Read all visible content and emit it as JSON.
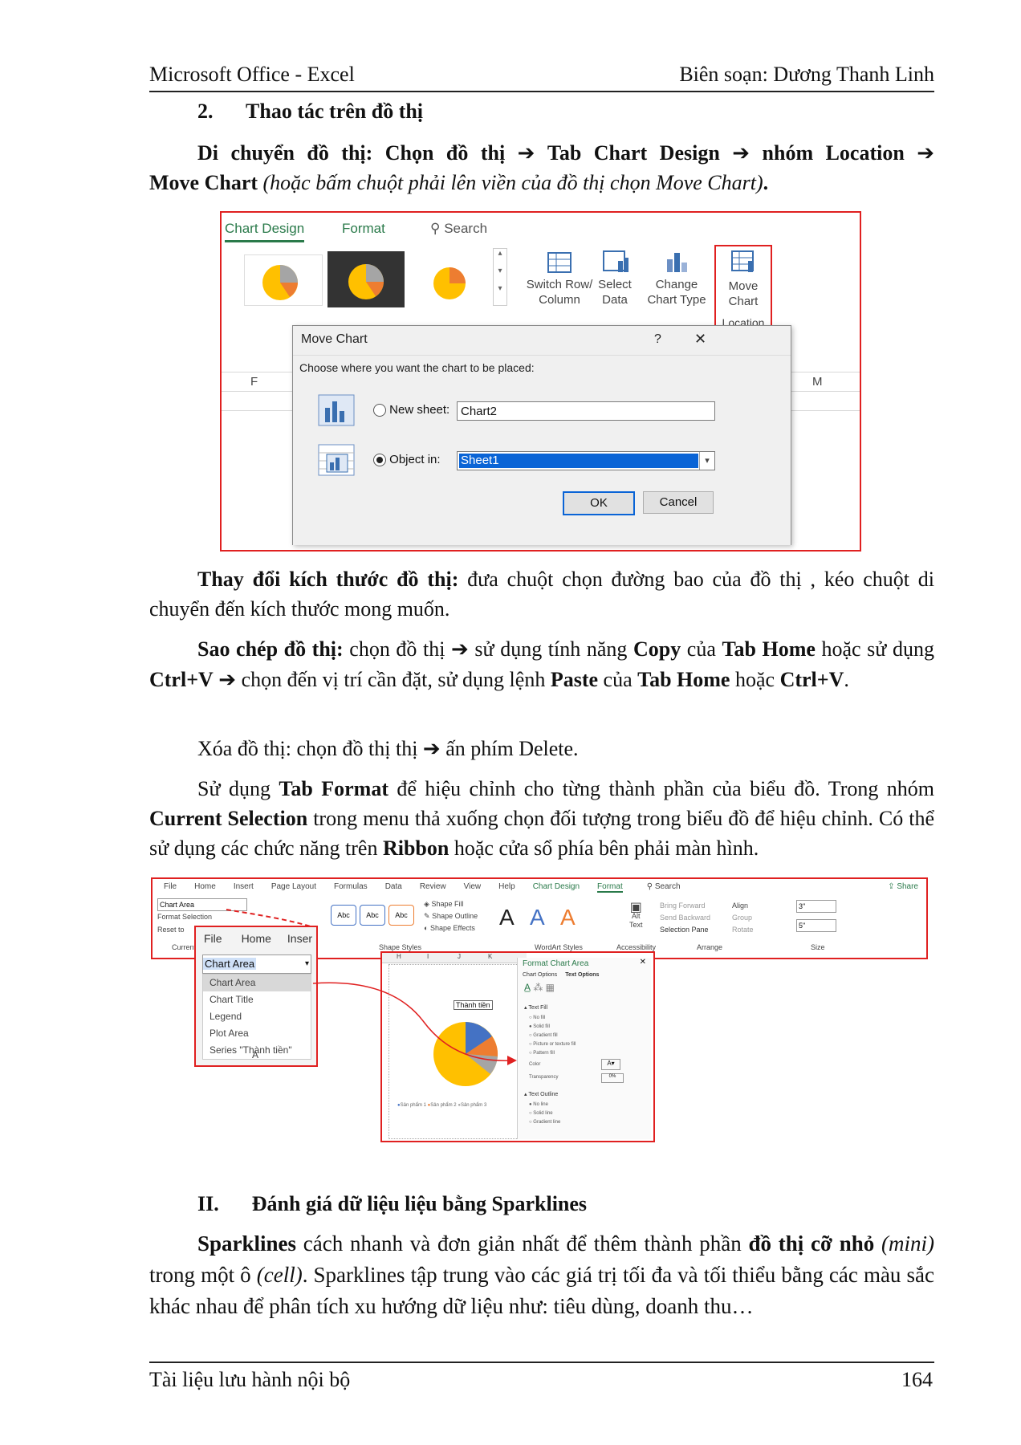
{
  "header": {
    "left": "Microsoft Office - Excel",
    "right": "Biên soạn: Dương Thanh Linh"
  },
  "section2": {
    "num": "2.",
    "title": "Thao tác trên đồ thị"
  },
  "para_move": {
    "b1": "Di chuyển đồ thị: Chọn đồ thị",
    "b2": "Tab Chart Design",
    "b3": "nhóm Location",
    "b4": "Move Chart",
    "i1": "(hoặc bấm chuột phải lên viền của đồ thị chọn Move Chart)",
    "end": "."
  },
  "arrow": "➔",
  "fig1": {
    "tab_chart_design": "Chart Design",
    "tab_format": "Format",
    "search": "Search",
    "btn_switch": [
      "Switch Row/",
      "Column"
    ],
    "btn_select": [
      "Select",
      "Data"
    ],
    "btn_change": [
      "Change",
      "Chart Type"
    ],
    "btn_move": [
      "Move",
      "Chart"
    ],
    "group_location": "Location",
    "col_f": "F",
    "col_m": "M",
    "dialog_title": "Move Chart",
    "dialog_help": "?",
    "dialog_close": "✕",
    "dialog_prompt": "Choose where you want the chart to be placed:",
    "opt_new_sheet": "New sheet:",
    "new_sheet_value": "Chart2",
    "opt_object_in": "Object in:",
    "object_in_value": "Sheet1",
    "ok": "OK",
    "cancel": "Cancel"
  },
  "para_resize": {
    "b": "Thay đổi kích thước đồ thị:",
    "t": " đưa chuột chọn đường bao của đồ thị , kéo chuột di chuyển đến kích thước mong muốn."
  },
  "para_copy": {
    "b1": "Sao chép đồ thị:",
    "t1": " chọn đồ thị ",
    "t2": " sử dụng tính năng ",
    "b2": "Copy",
    "t3": " của ",
    "b3": "Tab Home",
    "t4": " hoặc sử dụng ",
    "b4": "Ctrl+V",
    "t5": " ",
    "t6": " chọn đến vị trí cần đặt, sử dụng lệnh ",
    "b5": "Paste",
    "t7": " của ",
    "b6": "Tab Home",
    "t8": " hoặc ",
    "b7": "Ctrl+V",
    "t9": "."
  },
  "para_delete": {
    "t1": "Xóa đồ thị: chọn đồ thị thị ",
    "t2": " ấn phím Delete."
  },
  "para_format": {
    "t1": "Sử dụng ",
    "b1": "Tab Format",
    "t2": " để hiệu chỉnh cho từng thành phần của biểu đồ. Trong nhóm ",
    "b2": "Current Selection",
    "t3": " trong menu thả xuống chọn đối tượng trong biểu đồ để hiệu chỉnh. Có thể sử dụng các chức năng trên ",
    "b3": "Ribbon",
    "t4": " hoặc cửa sổ phía bên phải màn hình."
  },
  "fig2": {
    "tabs": [
      "File",
      "Home",
      "Insert",
      "Page Layout",
      "Formulas",
      "Data",
      "Review",
      "View",
      "Help",
      "Chart Design",
      "Format"
    ],
    "search": "Search",
    "share": "Share",
    "chart_area_box": "Chart Area",
    "format_selection": "Format Selection",
    "reset": "Reset to",
    "current": "Current",
    "shape_fill": "Shape Fill",
    "shape_outline": "Shape Outline",
    "shape_effects": "Shape Effects",
    "abc": "Abc",
    "group_shape_styles": "Shape Styles",
    "group_wordart": "WordArt Styles",
    "group_accessibility": "Accessibility",
    "group_arrange": "Arrange",
    "group_size": "Size",
    "alt_text": [
      "Alt",
      "Text"
    ],
    "bring_forward": "Bring Forward",
    "send_backward": "Send Backward",
    "selection_pane": "Selection Pane",
    "align": "Align",
    "group": "Group",
    "rotate": "Rotate",
    "size_h": "3\"",
    "size_w": "5\"",
    "letter_a": "A",
    "dd_tabs": [
      "File",
      "Home",
      "Inser"
    ],
    "dd_selected": "Chart Area",
    "dd_items": [
      "Chart Area",
      "Chart Title",
      "Legend",
      "Plot Area",
      "Series \"Thành tiền\""
    ],
    "dd_col": "A",
    "sheet_cols": [
      "H",
      "I",
      "J",
      "K"
    ],
    "chart_title": "Thành tiền",
    "legend": [
      "Sản phẩm 1",
      "Sản phẩm 2",
      "Sản phẩm 3"
    ],
    "pane_title": "Format Chart Area",
    "pane_tabs": [
      "Chart Options",
      "Text Options"
    ],
    "text_fill": "Text Fill",
    "fill_opts": [
      "No fill",
      "Solid fill",
      "Gradient fill",
      "Picture or texture fill",
      "Pattern fill"
    ],
    "color": "Color",
    "transparency": "Transparency",
    "transparency_val": "0%",
    "text_outline": "Text Outline",
    "outline_opts": [
      "No line",
      "Solid line",
      "Gradient line"
    ]
  },
  "section_ii": {
    "num": "II.",
    "title": "Đánh giá dữ liệu liệu bằng Sparklines"
  },
  "para_spark": {
    "b1": "Sparklines",
    "t1": " cách nhanh và đơn giản nhất để thêm thành phần ",
    "b2": "đồ thị cỡ nhỏ",
    "i1": " (mini)",
    "t2": " trong một ô ",
    "i2": "(cell)",
    "t3": ". Sparklines tập trung vào các giá trị tối đa và tối thiểu bằng các màu sắc khác nhau để phân tích xu hướng dữ liệu như: tiêu dùng, doanh thu…"
  },
  "footer": {
    "left": "Tài liệu lưu hành nội bộ",
    "right": "164"
  },
  "colors": {
    "red_frame": "#e02020",
    "excel_green": "#2a7a4a",
    "pie_blue": "#4472c4",
    "pie_orange": "#ed7d31",
    "pie_gray": "#a5a5a5",
    "pie_yellow": "#ffc000"
  }
}
